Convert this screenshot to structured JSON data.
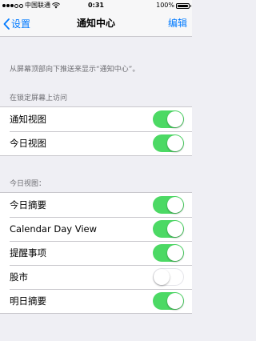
{
  "status_bar": {
    "carrier": "中国联通",
    "time": "0:31",
    "battery": "100%"
  },
  "nav": {
    "back_label": "设置",
    "title": "通知中心",
    "edit_label": "编辑"
  },
  "description": "从屏幕顶部向下推送来显示“通知中心”。",
  "lock_screen": {
    "header": "在锁定屏幕上访问",
    "items": [
      {
        "label": "通知视图",
        "on": true
      },
      {
        "label": "今日视图",
        "on": true
      }
    ]
  },
  "today_view": {
    "header": "今日视图：",
    "items": [
      {
        "label": "今日摘要",
        "on": true
      },
      {
        "label": "Calendar Day View",
        "on": true
      },
      {
        "label": "提醒事项",
        "on": true
      },
      {
        "label": "股市",
        "on": false
      },
      {
        "label": "明日摘要",
        "on": true
      }
    ]
  },
  "colors": {
    "accent": "#007aff",
    "switch_on": "#4cd964",
    "background": "#efeff4"
  }
}
